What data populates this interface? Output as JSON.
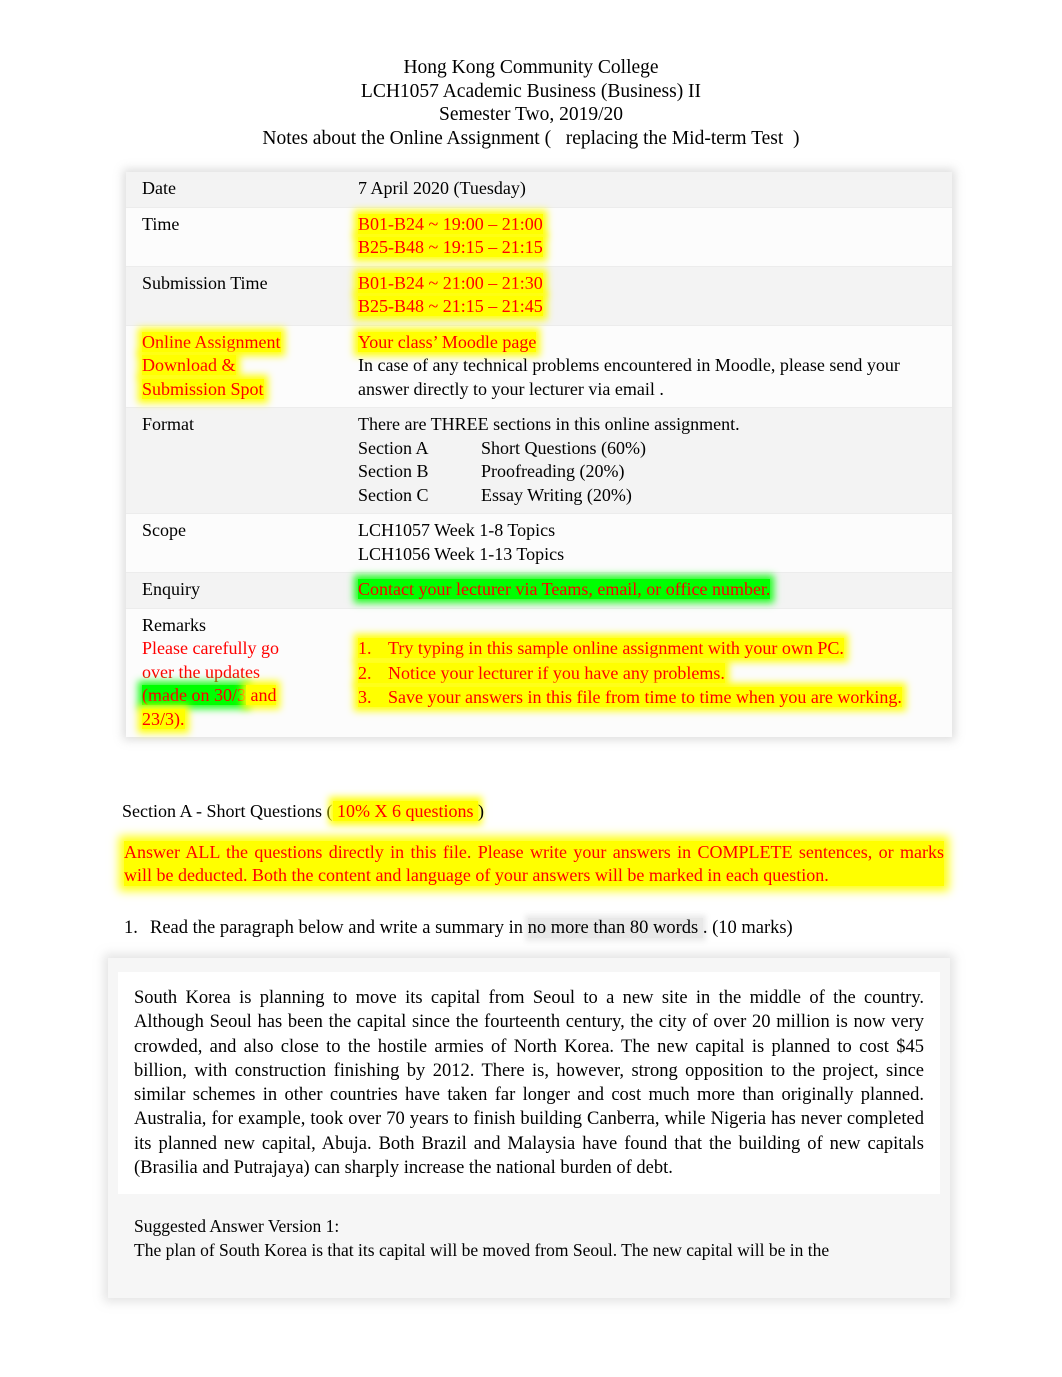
{
  "header": {
    "line1": "Hong Kong Community College",
    "line2": "LCH1057 Academic Business (Business) II",
    "line3": "Semester Two, 2019/20",
    "line4": "Notes about the Online Assignment (   replacing the Mid-term Test  )"
  },
  "colors": {
    "red": "#ff0000",
    "yellow_highlight": "#ffff00",
    "green_highlight": "#00ff00",
    "grey_highlight": "#e8e8e8"
  },
  "info_table": {
    "date": {
      "label": "Date",
      "value": "7 April 2020 (Tuesday)"
    },
    "time": {
      "label": "Time",
      "line1": "B01-B24 ~ 19:00 – 21:00",
      "line2": "B25-B48 ~ 19:15 – 21:15"
    },
    "submission_time": {
      "label": "Submission Time",
      "line1": "B01-B24 ~ 21:00 – 21:30",
      "line2": "B25-B48 ~ 21:15 – 21:45"
    },
    "spot": {
      "label_line1": "Online Assignment",
      "label_line2": "Download &",
      "label_line3": "Submission Spot",
      "value_line1": "Your class’ Moodle page",
      "value_line2": "In case of any technical problems encountered in Moodle, please send your",
      "value_line3": "answer directly to your lecturer via email ."
    },
    "format": {
      "label": "Format",
      "intro": "There are THREE sections in this online assignment.",
      "sections": [
        {
          "name": "Section A",
          "detail": "Short Questions (60%)"
        },
        {
          "name": "Section B",
          "detail": "Proofreading (20%)"
        },
        {
          "name": "Section C",
          "detail": "Essay Writing (20%)"
        }
      ]
    },
    "scope": {
      "label": "Scope",
      "line1": "LCH1057 Week 1-8 Topics",
      "line2": "LCH1056 Week 1-13 Topics"
    },
    "enquiry": {
      "label": "Enquiry",
      "value": "Contact your lecturer via Teams, email, or office number."
    },
    "remarks": {
      "label": "Remarks",
      "note_line1": "Please carefully go",
      "note_line2": "over the updates",
      "note_line3_green": "(made on 30/3",
      "note_line3_yellow": " and",
      "note_line4": "23/3).",
      "items": [
        {
          "num": "1.",
          "text": "Try typing in this sample online assignment with your own PC."
        },
        {
          "num": "2.",
          "text": "Notice your lecturer if you have any problems."
        },
        {
          "num": "3.",
          "text": "Save your answers in this file from time to time when you are working."
        }
      ]
    }
  },
  "section_a": {
    "heading_prefix": "Section A - Short Questions (",
    "heading_highlight": " 10%  X 6 questions ",
    "heading_suffix": ")",
    "instructions": "Answer ALL the questions directly in this file.     Please write your answers in COMPLETE sentences, or marks will be deducted.     Both the content and language of your answers will be marked in each question."
  },
  "question1": {
    "num": "1.",
    "part1": "Read the paragraph below and write a summary in ",
    "highlight": "no more than 80 words ",
    "part2": ". (10 marks)",
    "passage": "South Korea is planning to move its capital from Seoul to a new site in the middle of the country. Although Seoul has been the capital since the fourteenth century, the city of over 20 million is now very crowded, and also close to the hostile armies of North Korea. The new capital is planned to cost $45 billion, with construction finishing by 2012. There is, however, strong opposition to the project, since similar schemes in other countries have taken far longer and cost much more than originally planned. Australia, for example, took over 70 years to finish building Canberra, while Nigeria has never completed its planned new capital, Abuja. Both Brazil and Malaysia have found that the building of new capitals (Brasilia and Putrajaya) can sharply increase the national burden of debt.",
    "answer_label": "Suggested Answer Version 1:",
    "answer_line1": "The plan of South Korea is that its capital will be moved from Seoul. The new capital will be in the"
  }
}
